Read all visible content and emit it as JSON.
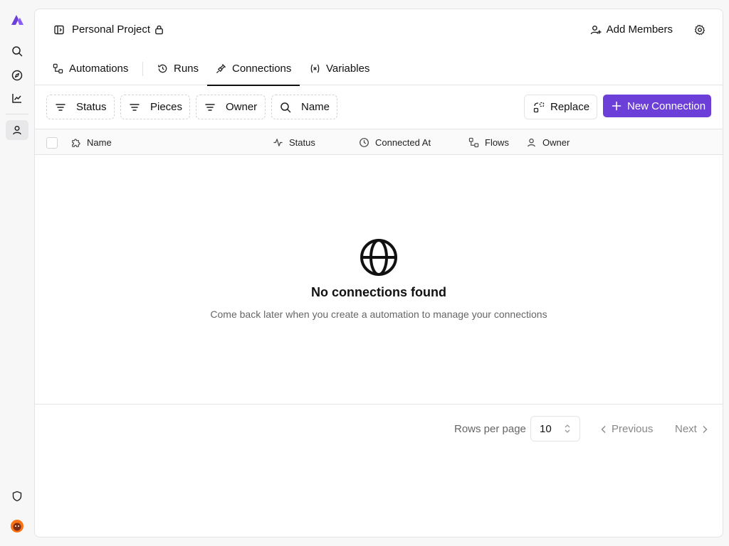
{
  "project": {
    "title": "Personal Project"
  },
  "header": {
    "add_members_label": "Add Members"
  },
  "tabs": [
    {
      "label": "Automations",
      "active": false
    },
    {
      "label": "Runs",
      "active": false
    },
    {
      "label": "Connections",
      "active": true
    },
    {
      "label": "Variables",
      "active": false
    }
  ],
  "filters": [
    {
      "label": "Status",
      "icon": "filter-icon"
    },
    {
      "label": "Pieces",
      "icon": "filter-icon"
    },
    {
      "label": "Owner",
      "icon": "filter-icon"
    },
    {
      "label": "Name",
      "icon": "search-icon"
    }
  ],
  "actions": {
    "replace_label": "Replace",
    "new_connection_label": "New Connection"
  },
  "table": {
    "columns": [
      {
        "label": "Name",
        "icon": "puzzle-icon"
      },
      {
        "label": "Status",
        "icon": "activity-icon"
      },
      {
        "label": "Connected At",
        "icon": "clock-icon"
      },
      {
        "label": "Flows",
        "icon": "workflow-icon"
      },
      {
        "label": "Owner",
        "icon": "user-icon"
      }
    ],
    "rows": []
  },
  "empty_state": {
    "icon": "globe-icon",
    "title": "No connections found",
    "subtitle": "Come back later when you create a automation to manage your connections"
  },
  "pagination": {
    "rows_per_page_label": "Rows per page",
    "rows_per_page_value": "10",
    "previous_label": "Previous",
    "next_label": "Next"
  },
  "colors": {
    "accent": "#6d3fd9",
    "logo": "#7c3aed"
  }
}
